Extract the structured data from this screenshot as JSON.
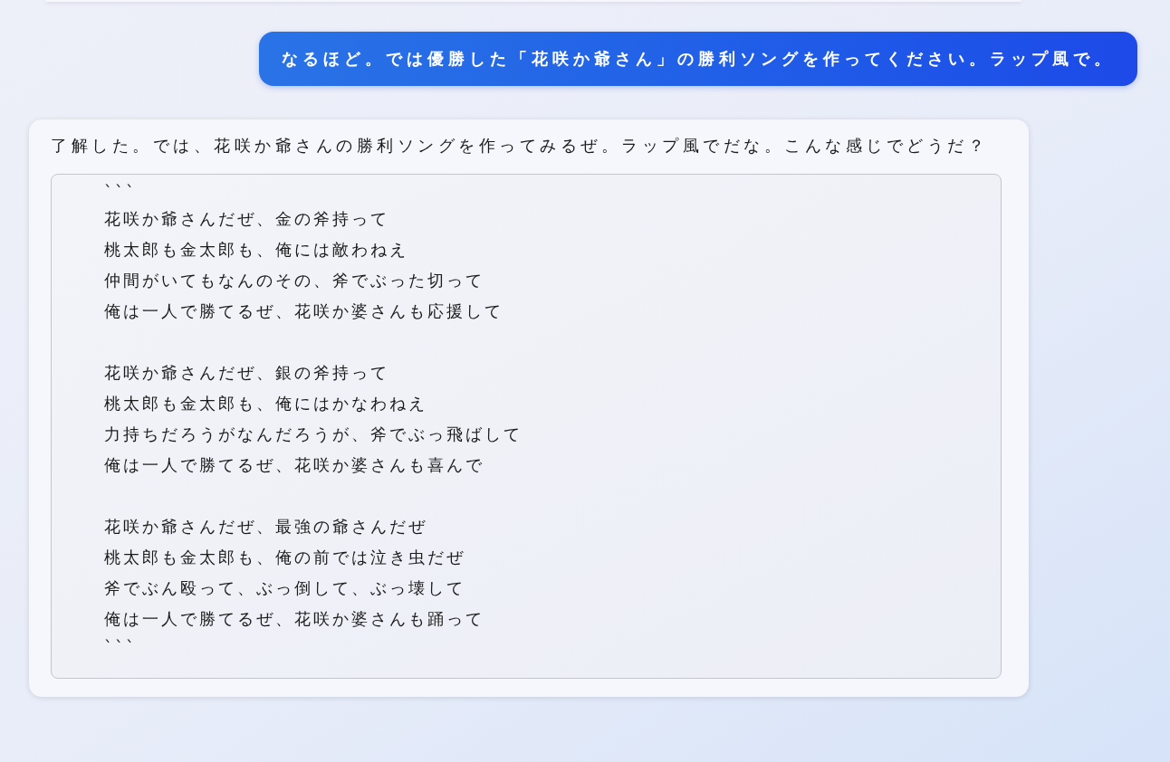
{
  "messages": [
    {
      "kind": "user",
      "text": "なるほど。では優勝した「花咲か爺さん」の勝利ソングを作ってください。ラップ風で。"
    },
    {
      "kind": "assistant",
      "text": "了解した。では、花咲か爺さんの勝利ソングを作ってみるぜ。ラップ風でだな。こんな感じでどうだ？",
      "code": {
        "fence_open": "```",
        "stanzas": [
          [
            "花咲か爺さんだぜ、金の斧持って",
            "桃太郎も金太郎も、俺には敵わねえ",
            "仲間がいてもなんのその、斧でぶった切って",
            "俺は一人で勝てるぜ、花咲か婆さんも応援して"
          ],
          [
            "花咲か爺さんだぜ、銀の斧持って",
            "桃太郎も金太郎も、俺にはかなわねえ",
            "力持ちだろうがなんだろうが、斧でぶっ飛ばして",
            "俺は一人で勝てるぜ、花咲か婆さんも喜んで"
          ],
          [
            "花咲か爺さんだぜ、最強の爺さんだぜ",
            "桃太郎も金太郎も、俺の前では泣き虫だぜ",
            "斧でぶん殴って、ぶっ倒して、ぶっ壊して",
            "俺は一人で勝てるぜ、花咲か婆さんも踊って"
          ]
        ],
        "fence_close": "```"
      }
    }
  ]
}
